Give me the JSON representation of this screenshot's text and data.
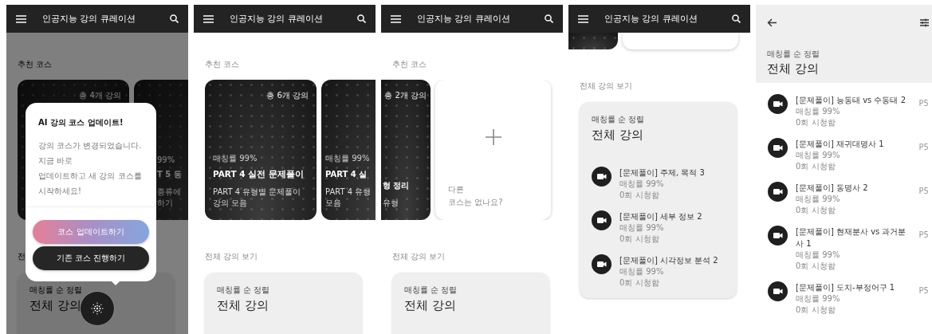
{
  "screens": [
    {
      "kind": "home-dialog",
      "app_bar": {
        "title": "인공지능 강의 큐레이션"
      },
      "recommended_title": "추천 코스",
      "courses": [
        {
          "kind": "full",
          "count": "총 4개 강의"
        },
        {
          "kind": "cut-right",
          "match": "99%",
          "title": "T 5 동",
          "description": "종류에\n하기"
        }
      ],
      "all_title": "전",
      "panel": {
        "sort_label": "매칭률 순 정렬",
        "title": "전체 강의"
      },
      "dialog": {
        "title": "AI 강의 코스 업데이트!",
        "body": "강의 코스가 변경되었습니다. 지금 바로\n업데이트하고 새 강의 코스를\n시작하세요!",
        "buttons": [
          {
            "kind": "primary",
            "label": "코스 업데이트하기"
          },
          {
            "kind": "secondary",
            "label": "기존 코스 진행하기"
          }
        ]
      }
    },
    {
      "kind": "home",
      "app_bar": {
        "title": "인공지능 강의 큐레이션"
      },
      "recommended_title": "추천 코스",
      "courses": [
        {
          "kind": "full",
          "count": "총 6개 강의",
          "match": "매칭률 99%",
          "title": "PART 4 실전 문제풀이",
          "description": "PART 4 유형별 문제풀이 강의 모음"
        },
        {
          "kind": "cut-right",
          "match": "매칭률 99%",
          "title": "PART 4 실",
          "description": "PART 4 유형\n모음"
        }
      ],
      "all_title": "전체 강의 보기",
      "panel": {
        "sort_label": "매칭률 순 정렬",
        "title": "전체 강의"
      }
    },
    {
      "kind": "home",
      "app_bar": {
        "title": "인공지능 강의 큐레이션"
      },
      "recommended_title": "추천 코스",
      "courses": [
        {
          "kind": "cut-left",
          "count": "총 2개 강의",
          "title": "형 정리",
          "description": "유형"
        },
        {
          "kind": "add",
          "prompt": "다른\n코스는 없나요?"
        }
      ],
      "all_title": "전체 강의 보기",
      "panel": {
        "sort_label": "매칭률 순 정렬",
        "title": "전체 강의"
      }
    },
    {
      "kind": "home-scrolled",
      "app_bar": {
        "title": "인공지능 강의 큐레이션"
      },
      "all_title": "전체 강의 보기",
      "panel": {
        "sort_label": "매칭률 순 정렬",
        "title": "전체 강의",
        "lectures": [
          {
            "title": "[문제풀이] 주제, 목적 3",
            "match": "매칭률 99%",
            "views": "0회 시청함"
          },
          {
            "title": "[문제풀이] 세부 정보 2",
            "match": "매칭률 99%",
            "views": "0회 시청함"
          },
          {
            "title": "[문제풀이] 시각정보 분석 2",
            "match": "매칭률 99%",
            "views": "0회 시청함"
          }
        ]
      }
    },
    {
      "kind": "list",
      "sort_label": "매칭률 순 정렬",
      "title": "전체 강의",
      "lectures": [
        {
          "title": "[문제풀이] 능동태 vs 수동태 2",
          "match": "매칭률 99%",
          "views": "0회 시청함",
          "page": "P5"
        },
        {
          "title": "[문제풀이] 재귀대명사 1",
          "match": "매칭률 99%",
          "views": "0회 시청함",
          "page": "P5"
        },
        {
          "title": "[문제풀이] 동명사 2",
          "match": "매칭률 99%",
          "views": "0회 시청함",
          "page": "P5"
        },
        {
          "title": "[문제풀이] 현재분사 vs 과거분사 1",
          "match": "매칭률 99%",
          "views": "0회 시청함",
          "page": "P5"
        },
        {
          "title": "[문제풀이] 도치-부정어구 1",
          "match": "매칭률 99%",
          "views": "0회 시청함",
          "page": "P5"
        }
      ]
    }
  ]
}
